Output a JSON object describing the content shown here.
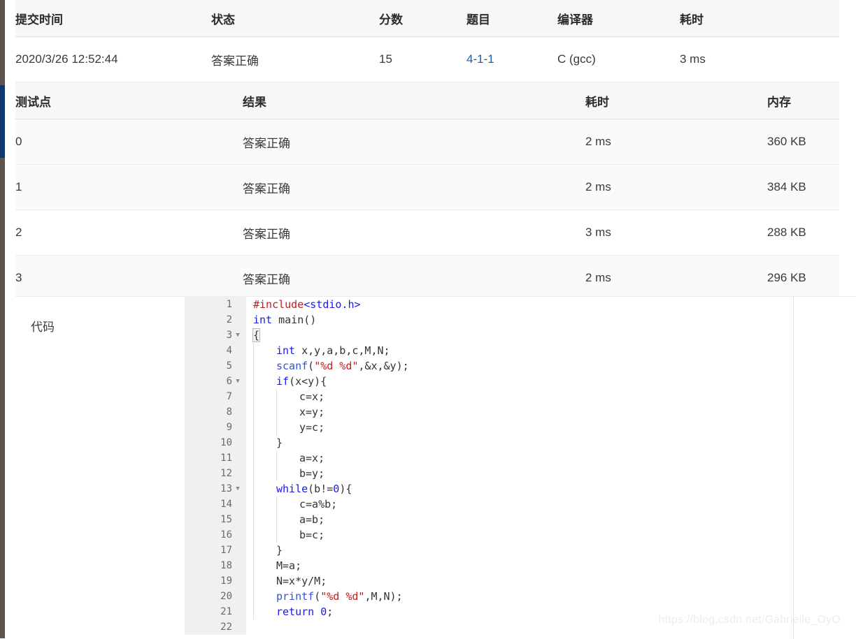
{
  "submission_table": {
    "headers": [
      "提交时间",
      "状态",
      "分数",
      "题目",
      "编译器",
      "耗时"
    ],
    "rows": [
      {
        "time": "2020/3/26 12:52:44",
        "status": "答案正确",
        "score": "15",
        "problem": "4-1-1",
        "compiler": "C (gcc)",
        "duration": "3 ms"
      }
    ]
  },
  "testpoint_table": {
    "headers": [
      "测试点",
      "结果",
      "耗时",
      "内存"
    ],
    "rows": [
      {
        "index": "0",
        "result": "答案正确",
        "time": "2 ms",
        "memory": "360 KB"
      },
      {
        "index": "1",
        "result": "答案正确",
        "time": "2 ms",
        "memory": "384 KB"
      },
      {
        "index": "2",
        "result": "答案正确",
        "time": "3 ms",
        "memory": "288 KB"
      },
      {
        "index": "3",
        "result": "答案正确",
        "time": "2 ms",
        "memory": "296 KB"
      }
    ]
  },
  "code_section": {
    "label": "代码",
    "language": "c",
    "lines": [
      {
        "n": "1",
        "fold": false,
        "text": "#include<stdio.h>"
      },
      {
        "n": "2",
        "fold": false,
        "text": "int main()"
      },
      {
        "n": "3",
        "fold": true,
        "text": "{"
      },
      {
        "n": "4",
        "fold": false,
        "text": "    int x,y,a,b,c,M,N;"
      },
      {
        "n": "5",
        "fold": false,
        "text": "    scanf(\"%d %d\",&x,&y);"
      },
      {
        "n": "6",
        "fold": true,
        "text": "    if(x<y){"
      },
      {
        "n": "7",
        "fold": false,
        "text": "        c=x;"
      },
      {
        "n": "8",
        "fold": false,
        "text": "        x=y;"
      },
      {
        "n": "9",
        "fold": false,
        "text": "        y=c;"
      },
      {
        "n": "10",
        "fold": false,
        "text": "    }"
      },
      {
        "n": "11",
        "fold": false,
        "text": "        a=x;"
      },
      {
        "n": "12",
        "fold": false,
        "text": "        b=y;"
      },
      {
        "n": "13",
        "fold": true,
        "text": "    while(b!=0){"
      },
      {
        "n": "14",
        "fold": false,
        "text": "        c=a%b;"
      },
      {
        "n": "15",
        "fold": false,
        "text": "        a=b;"
      },
      {
        "n": "16",
        "fold": false,
        "text": "        b=c;"
      },
      {
        "n": "17",
        "fold": false,
        "text": "    }"
      },
      {
        "n": "18",
        "fold": false,
        "text": "    M=a;"
      },
      {
        "n": "19",
        "fold": false,
        "text": "    N=x*y/M;"
      },
      {
        "n": "20",
        "fold": false,
        "text": "    printf(\"%d %d\",M,N);"
      },
      {
        "n": "21",
        "fold": false,
        "text": "    return 0;"
      },
      {
        "n": "22",
        "fold": false,
        "text": ""
      }
    ]
  },
  "watermark": {
    "text": "https://blog.csdn.net/Gabrielle_OyO"
  },
  "colors": {
    "accepted_red": "#fa4b4b",
    "link_blue": "#1661b3",
    "header_bg": "#f7f7f7",
    "gutter_bg": "#f0f0f0",
    "rail_dark": "#5a5350",
    "rail_accent": "#10386e"
  }
}
